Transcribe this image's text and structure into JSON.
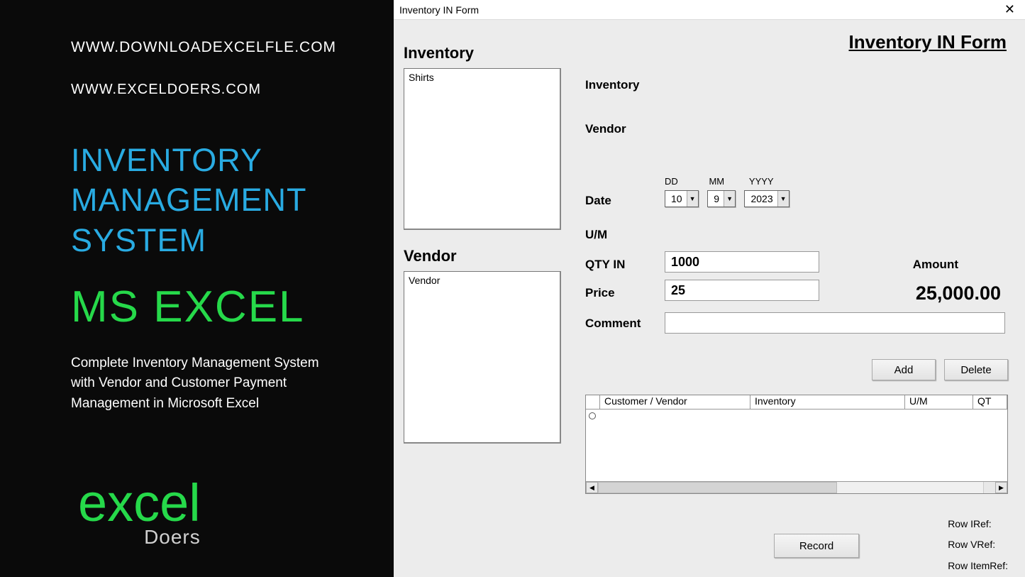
{
  "left": {
    "url1": "WWW.DOWNLOADEXCELFLE.COM",
    "url2": "WWW.EXCELDOERS.COM",
    "ims_line1": "INVENTORY",
    "ims_line2": "MANAGEMENT",
    "ims_line3": "SYSTEM",
    "msexcel": "MS EXCEL",
    "desc": "Complete Inventory Management System with Vendor and Customer Payment Management in Microsoft Excel",
    "logo_excel": "excel",
    "logo_doers": "Doers"
  },
  "window": {
    "title": "Inventory IN Form"
  },
  "form": {
    "heading_right": "Inventory IN Form",
    "inventory_heading": "Inventory",
    "vendor_heading": "Vendor",
    "inventory_list": [
      "Shirts"
    ],
    "vendor_list": [
      "Vendor"
    ],
    "labels": {
      "inventory": "Inventory",
      "vendor": "Vendor",
      "date": "Date",
      "um": "U/M",
      "qtyin": "QTY IN",
      "price": "Price",
      "comment": "Comment",
      "amount": "Amount"
    },
    "date": {
      "dd_head": "DD",
      "mm_head": "MM",
      "yyyy_head": "YYYY",
      "dd": "10",
      "mm": "9",
      "yyyy": "2023"
    },
    "qtyin": "1000",
    "price": "25",
    "comment": "",
    "amount": "25,000.00",
    "buttons": {
      "add": "Add",
      "delete": "Delete",
      "record": "Record"
    },
    "grid": {
      "headers": {
        "cv": "Customer / Vendor",
        "inv": "Inventory",
        "um": "U/M",
        "qt": "QT"
      }
    },
    "refs": {
      "iref": "Row IRef:",
      "vref": "Row VRef:",
      "itemref": "Row ItemRef:"
    }
  }
}
